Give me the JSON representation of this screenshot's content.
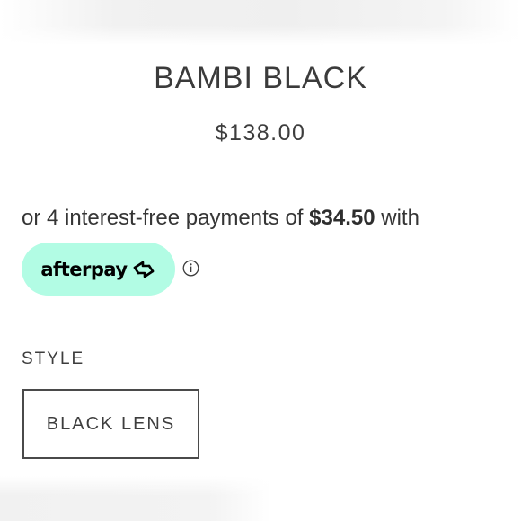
{
  "product": {
    "title": "BAMBI BLACK",
    "price": "$138.00"
  },
  "payment": {
    "text_before": "or 4 interest-free payments of ",
    "amount": "$34.50",
    "text_after": " with",
    "provider": "afterpay",
    "provider_color": "#b2fce4",
    "info_icon": "info-icon"
  },
  "style_selector": {
    "label": "STYLE",
    "options": [
      {
        "label": "BLACK LENS",
        "selected": true
      }
    ]
  }
}
